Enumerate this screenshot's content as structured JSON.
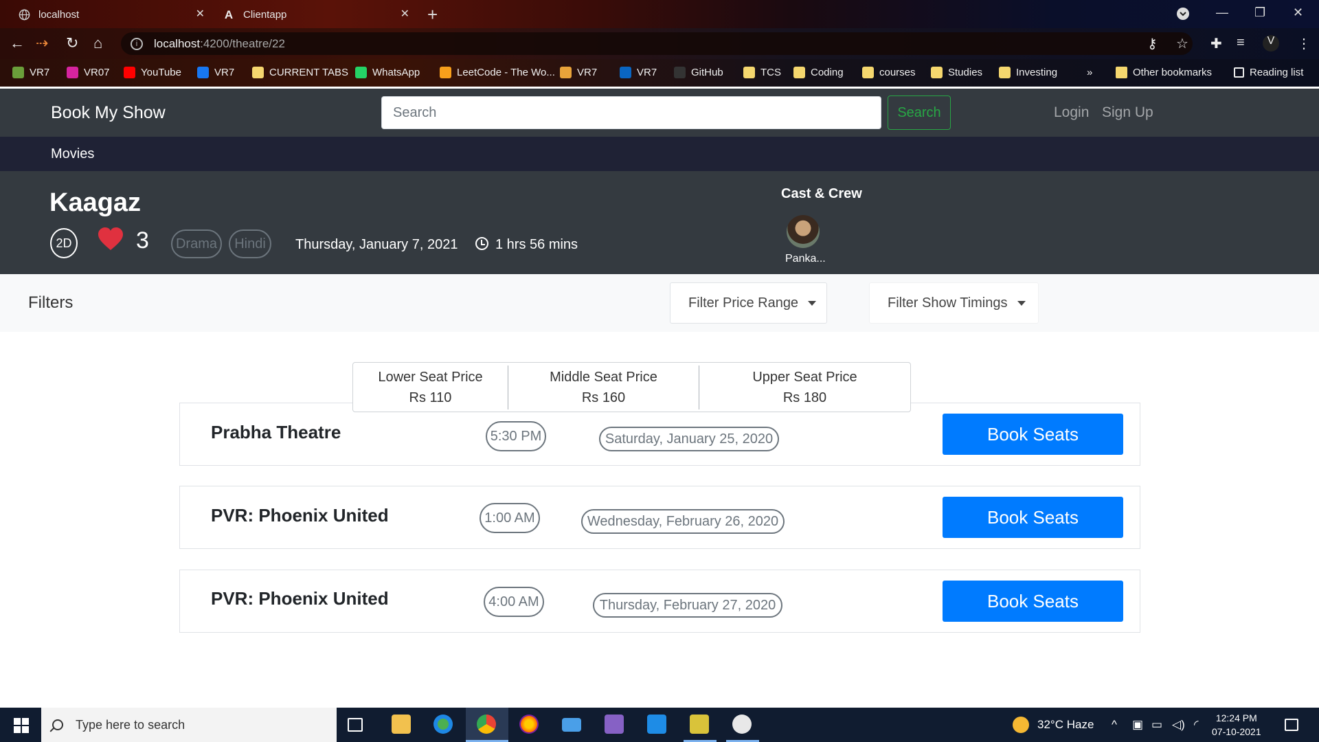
{
  "browser": {
    "tabs": [
      {
        "title": "localhost"
      },
      {
        "title": "Clientapp"
      }
    ],
    "address": {
      "host": "localhost",
      "path": ":4200/theatre/22"
    },
    "bookmarks": [
      {
        "label": "VR7",
        "color": "#6a9f3a"
      },
      {
        "label": "VR07",
        "color": "#d6249f"
      },
      {
        "label": "YouTube",
        "color": "#ff0000"
      },
      {
        "label": "VR7",
        "color": "#1877f2"
      },
      {
        "label": "CURRENT TABS",
        "color": "#f5d76e"
      },
      {
        "label": "WhatsApp",
        "color": "#25d366"
      },
      {
        "label": "LeetCode - The Wo...",
        "color": "#f89f1b"
      },
      {
        "label": "VR7",
        "color": "#e8a33a"
      },
      {
        "label": "VR7",
        "color": "#0a66c2"
      },
      {
        "label": "GitHub",
        "color": "#333333"
      },
      {
        "label": "TCS",
        "color": "#f5d76e"
      },
      {
        "label": "Coding",
        "color": "#f5d76e"
      },
      {
        "label": "courses",
        "color": "#f5d76e"
      },
      {
        "label": "Studies",
        "color": "#f5d76e"
      },
      {
        "label": "Investing",
        "color": "#f5d76e"
      }
    ],
    "more_bookmarks": "»",
    "other_bookmarks": "Other bookmarks",
    "reading_list": "Reading list"
  },
  "header": {
    "brand": "Book My Show",
    "search_placeholder": "Search",
    "search_button": "Search",
    "login": "Login",
    "signup": "Sign Up"
  },
  "subnav": {
    "movies": "Movies"
  },
  "movie": {
    "title": "Kaagaz",
    "format": "2D",
    "likes": "3",
    "genres": [
      "Drama",
      "Hindi"
    ],
    "release_date": "Thursday, January 7, 2021",
    "duration": "1 hrs 56 mins",
    "cast_heading": "Cast & Crew",
    "cast": [
      {
        "name": "Panka..."
      }
    ]
  },
  "filters": {
    "label": "Filters",
    "price_range": "Filter Price Range",
    "show_timings": "Filter Show Timings"
  },
  "prices": [
    {
      "label": "Lower Seat Price",
      "value": "Rs 110"
    },
    {
      "label": "Middle Seat Price",
      "value": "Rs 160"
    },
    {
      "label": "Upper Seat Price",
      "value": "Rs 180"
    }
  ],
  "shows": [
    {
      "theatre": "Prabha Theatre",
      "time": "5:30 PM",
      "date": "Saturday, January 25, 2020",
      "button": "Book Seats"
    },
    {
      "theatre": "PVR: Phoenix United",
      "time": "1:00 AM",
      "date": "Wednesday, February 26, 2020",
      "button": "Book Seats"
    },
    {
      "theatre": "PVR: Phoenix United",
      "time": "4:00 AM",
      "date": "Thursday, February 27, 2020",
      "button": "Book Seats"
    }
  ],
  "taskbar": {
    "search_placeholder": "Type here to search",
    "weather": "32°C  Haze",
    "time": "12:24 PM",
    "date": "07-10-2021"
  },
  "colors": {
    "primary": "#007bff",
    "success": "#28a745",
    "dark": "#343a40",
    "heart": "#e0313f"
  }
}
